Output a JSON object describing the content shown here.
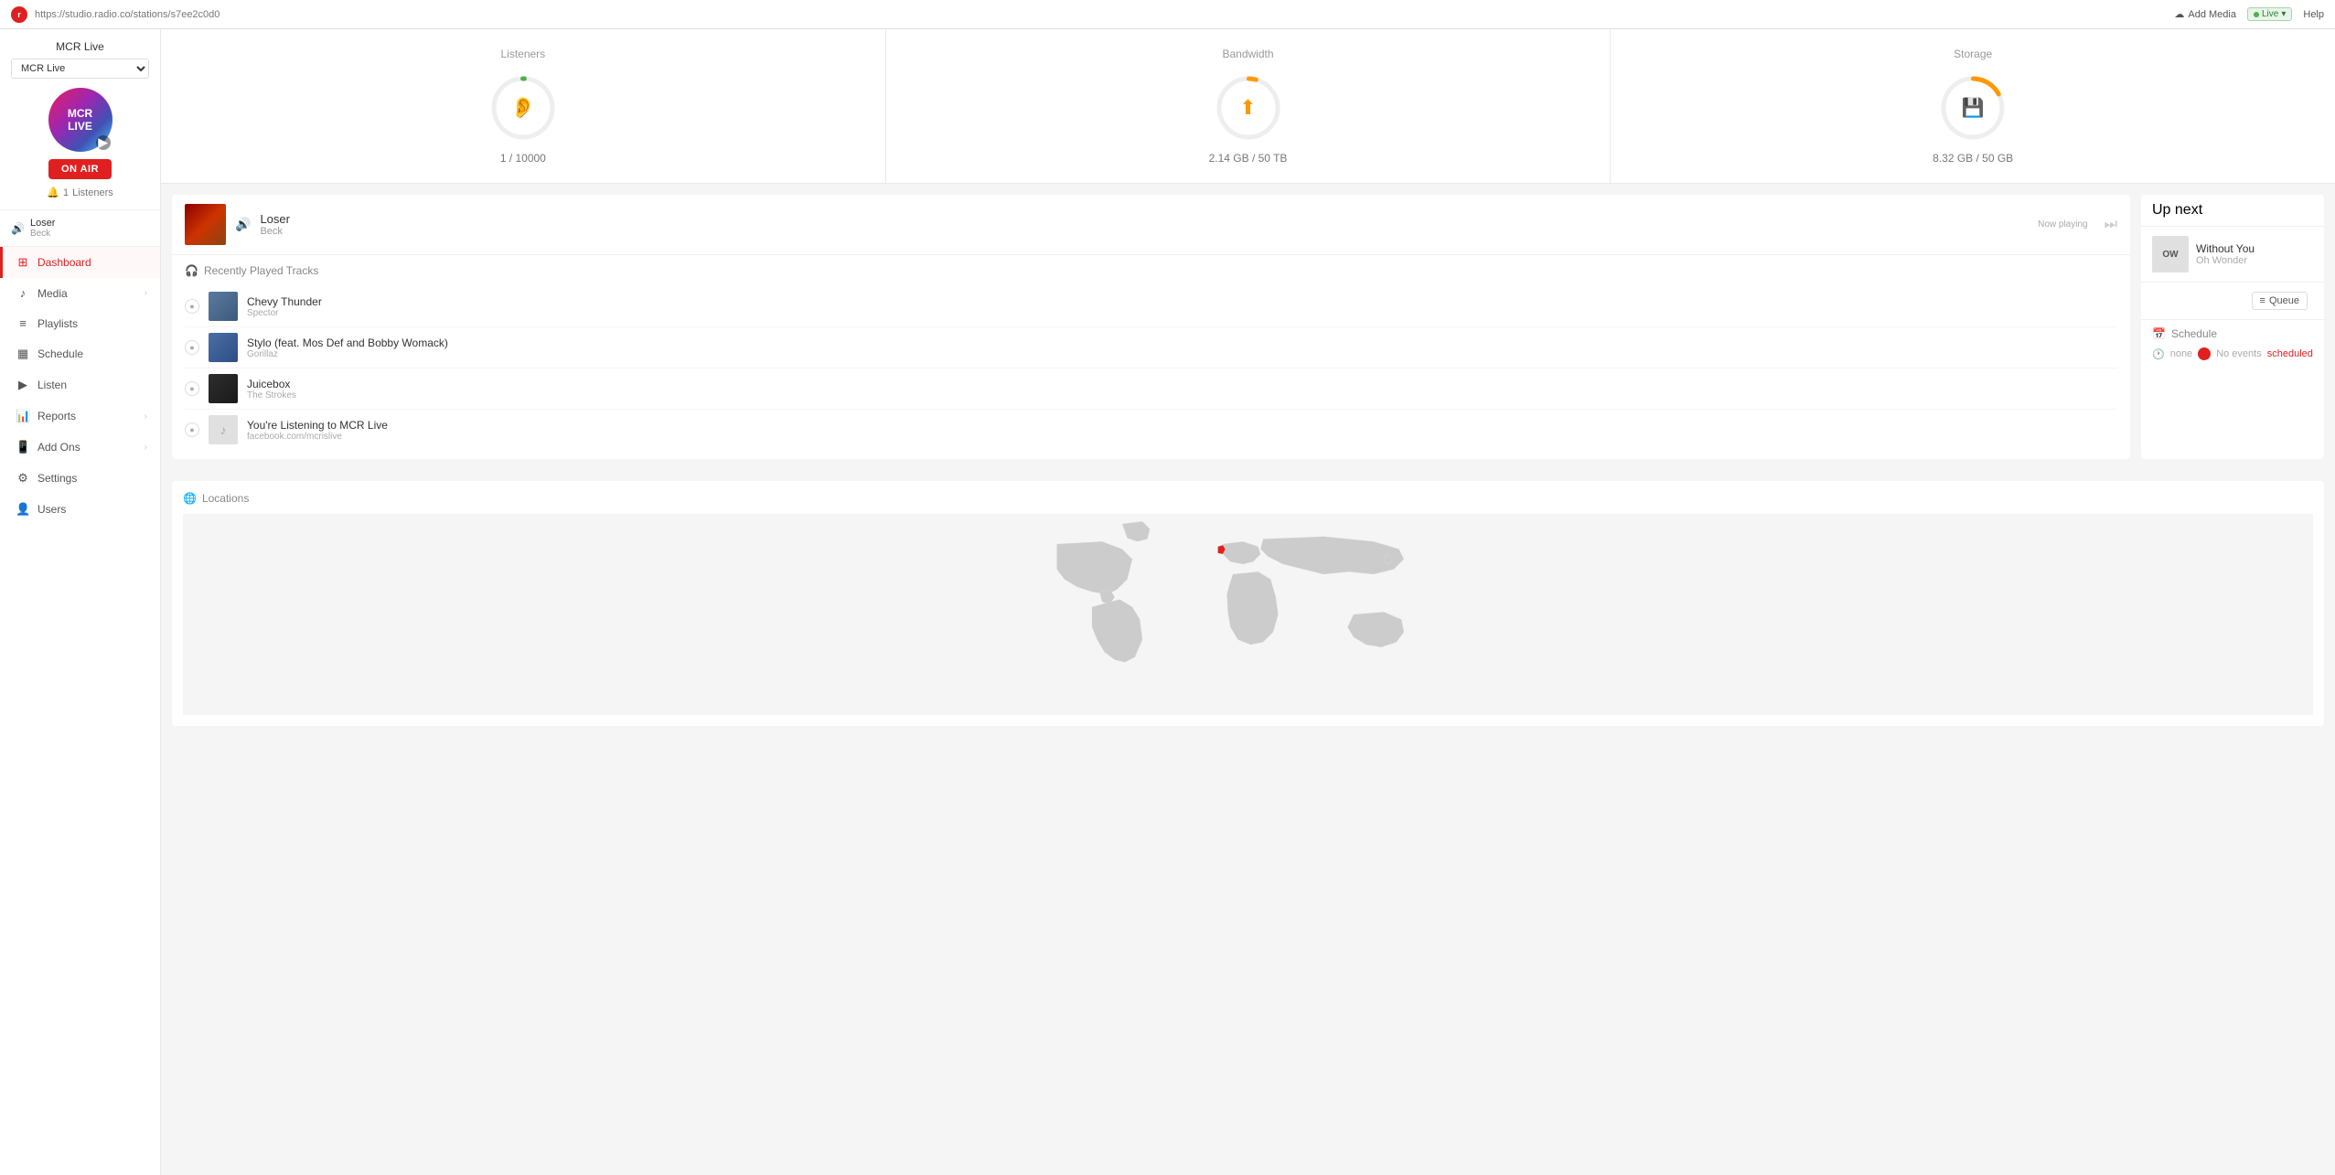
{
  "topbar": {
    "url": "https://studio.radio.co/stations/s7ee2c0d0",
    "add_media_label": "Add Media",
    "live_label": "Live",
    "help_label": "Help"
  },
  "sidebar": {
    "station_title": "MCR Live",
    "station_select_value": "MCR Live",
    "station_initials": "MCR\nLIVE",
    "on_air_label": "ON AIR",
    "listeners_count": "1",
    "listeners_label": "Listeners",
    "now_playing_title": "Loser",
    "now_playing_artist": "Beck",
    "nav_items": [
      {
        "id": "dashboard",
        "label": "Dashboard",
        "icon": "⊞",
        "active": true,
        "has_arrow": false
      },
      {
        "id": "media",
        "label": "Media",
        "icon": "♪",
        "active": false,
        "has_arrow": true
      },
      {
        "id": "playlists",
        "label": "Playlists",
        "icon": "≡",
        "active": false,
        "has_arrow": false
      },
      {
        "id": "schedule",
        "label": "Schedule",
        "icon": "📅",
        "active": false,
        "has_arrow": false
      },
      {
        "id": "listen",
        "label": "Listen",
        "icon": "▶",
        "active": false,
        "has_arrow": false
      },
      {
        "id": "reports",
        "label": "Reports",
        "icon": "📊",
        "active": false,
        "has_arrow": true
      },
      {
        "id": "addons",
        "label": "Add Ons",
        "icon": "📱",
        "active": false,
        "has_arrow": true
      },
      {
        "id": "settings",
        "label": "Settings",
        "icon": "⚙",
        "active": false,
        "has_arrow": false
      },
      {
        "id": "users",
        "label": "Users",
        "icon": "👤",
        "active": false,
        "has_arrow": false
      }
    ]
  },
  "stats": {
    "listeners": {
      "title": "Listeners",
      "value": "1 / 10000",
      "icon": "👂",
      "color": "#4caf50",
      "percent": 0.01
    },
    "bandwidth": {
      "title": "Bandwidth",
      "value": "2.14 GB / 50 TB",
      "icon": "⬆",
      "color": "#ff9800",
      "percent": 0.04
    },
    "storage": {
      "title": "Storage",
      "value": "8.32 GB / 50 GB",
      "icon": "💾",
      "color": "#ff9800",
      "percent": 0.17
    }
  },
  "now_playing": {
    "label": "Now playing",
    "track_title": "Loser",
    "track_artist": "Beck"
  },
  "recently_played": {
    "header": "Recently Played Tracks",
    "tracks": [
      {
        "name": "Chevy Thunder",
        "artist": "Spector",
        "num": "1"
      },
      {
        "name": "Stylo (feat. Mos Def and Bobby Womack)",
        "artist": "Gorillaz",
        "num": "2"
      },
      {
        "name": "Juicebox",
        "artist": "The Strokes",
        "num": "3"
      },
      {
        "name": "You're Listening to MCR Live",
        "artist": "facebook.com/mcrislive",
        "num": "4"
      }
    ]
  },
  "up_next": {
    "label": "Up next",
    "track_title": "Without You",
    "track_artist": "Oh Wonder",
    "queue_label": "Queue"
  },
  "schedule": {
    "header": "Schedule",
    "none_label": "none",
    "no_events_text": "No events",
    "scheduled_text": "scheduled"
  },
  "locations": {
    "header": "Locations"
  }
}
